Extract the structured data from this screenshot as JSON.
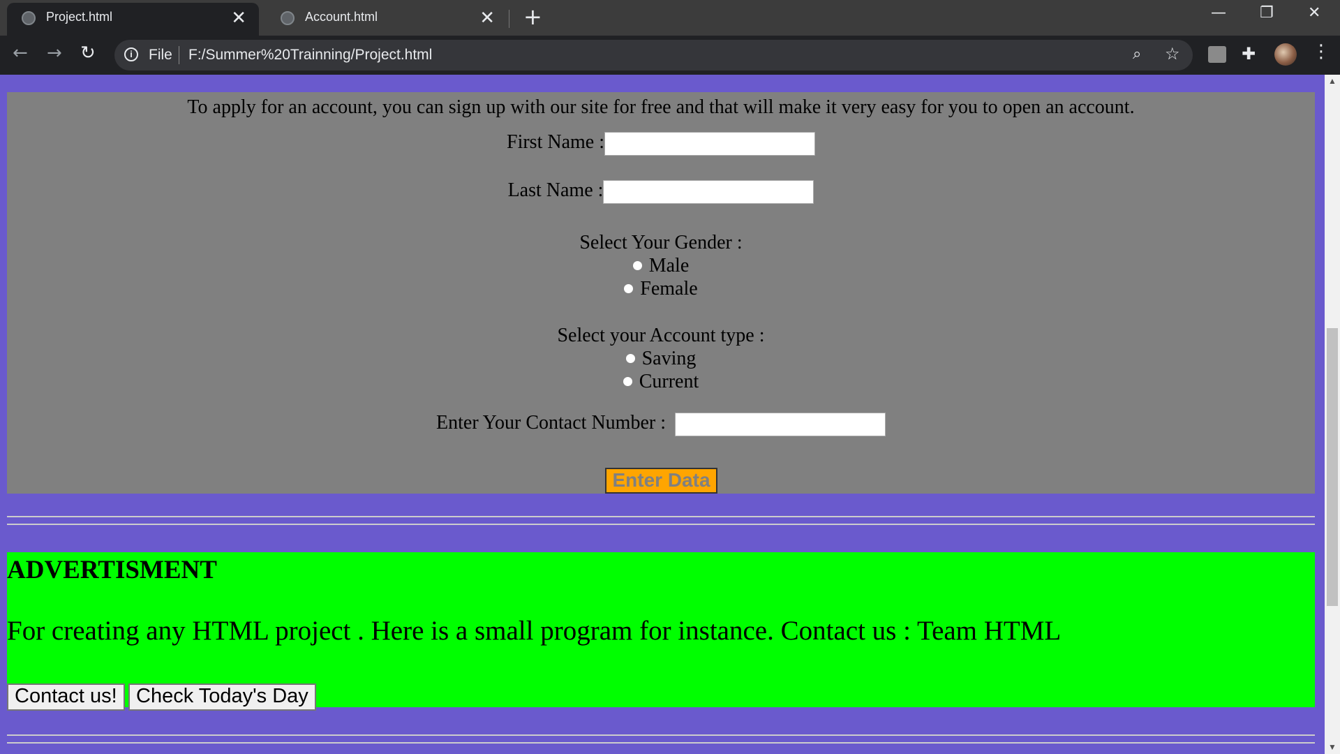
{
  "browser": {
    "tabs": [
      {
        "title": "Project.html",
        "close": "✕"
      },
      {
        "title": "Account.html",
        "close": "✕"
      }
    ],
    "new_tab": "+",
    "window_controls": {
      "minimize": "—",
      "restore": "❐",
      "close": "✕"
    },
    "nav": {
      "back": "←",
      "forward": "→",
      "reload": "↻"
    },
    "address": {
      "scheme_label": "File",
      "url": "F:/Summer%20Trainning/Project.html"
    },
    "icons": [
      "info-icon",
      "zoom-icon",
      "star-icon",
      "pdf-extension-icon",
      "extensions-puzzle-icon",
      "profile-avatar",
      "menu-kebab-icon"
    ]
  },
  "form": {
    "intro": "To apply for an account, you can sign up with our site for free and that will make it very easy for you to open an account.",
    "first_name_label": "First Name :",
    "first_name_value": "",
    "last_name_label": "Last Name :",
    "last_name_value": "",
    "gender_label": "Select Your Gender :",
    "gender_options": [
      "Male",
      "Female"
    ],
    "account_type_label": "Select your Account type :",
    "account_type_options": [
      "Saving",
      "Current"
    ],
    "contact_label": "Enter Your Contact Number :",
    "contact_value": "",
    "submit_label": "Enter Data"
  },
  "advertisement": {
    "title": "ADVERTISMENT",
    "text": "For creating any HTML project . Here is a small program for instance. Contact us : Team HTML",
    "buttons": [
      "Contact us!",
      "Check Today's Day"
    ]
  },
  "colors": {
    "page_background": "#6a5acd",
    "form_background": "#808080",
    "ad_background": "#00ff00",
    "submit_button": "#ffa500"
  }
}
